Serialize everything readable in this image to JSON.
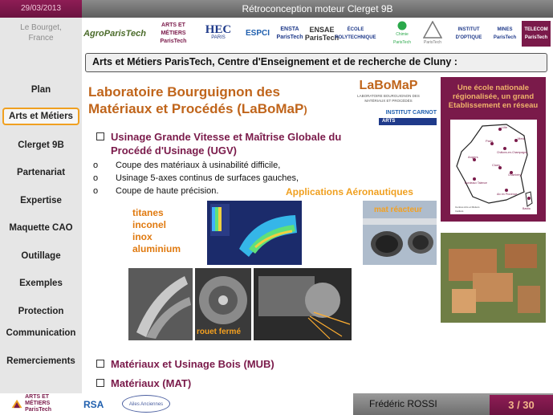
{
  "header": {
    "date": "29/03/2013",
    "title": "Rétroconception moteur Clerget 9B"
  },
  "sidebar": {
    "location_line1": "Le Bourget,",
    "location_line2": "France",
    "items": [
      {
        "label": "Plan"
      },
      {
        "label": "Arts et Métiers"
      },
      {
        "label": "Clerget 9B"
      },
      {
        "label": "Partenariat"
      },
      {
        "label": "Expertise"
      },
      {
        "label": "Maquette CAO"
      },
      {
        "label": "Outillage"
      },
      {
        "label": "Exemples"
      },
      {
        "label": "Protection"
      },
      {
        "label": "Communication"
      },
      {
        "label": "Remerciements"
      }
    ],
    "active_index": 1
  },
  "logos": {
    "agroparistech": "AgroParisTech",
    "artsetmetiers": "ARTS ET MÉTIERS ParisTech",
    "hec": "HEC",
    "hec_sub": "PARIS",
    "espci": "ESPCI",
    "ensta": "ENSTA ParisTech",
    "ensae": "ENSAE ParisTech",
    "polytechnique": "ÉCOLE POLYTECHNIQUE",
    "chimie": "Chimie ParisTech",
    "pontsparistech": "ParisTech",
    "institut_optique": "INSTITUT D'OPTIQUE",
    "mines": "MINES ParisTech",
    "telecom": "TELECOM ParisTech"
  },
  "banner": "Arts et Métiers ParisTech, Centre d'Enseignement et de recherche de Cluny :",
  "main": {
    "lab_title_line1": "Laboratoire Bourguignon des",
    "lab_title_line2": "Matériaux et Procédés (LaBoMaP",
    "lab_title_paren": ")",
    "labomap_logo": "LaBoMaP",
    "labomap_sub": "LABORATOIRE BOURGUIGNON DES MATÉRIAUX ET PROCÉDÉS",
    "carnot_logo": "INSTITUT CARNOT",
    "carnot_sub": "ARTS",
    "ugv_line1": "Usinage Grande Vitesse et Maîtrise Globale du",
    "ugv_line2": "Procédé d'Usinage (UGV)",
    "bullets": [
      "Coupe des matériaux à usinabilité difficile,",
      "Usinage 5-axes continus de surfaces gauches,",
      "Coupe de haute précision."
    ],
    "bullet_marker": "o",
    "applications": "Applications Aéronautiques",
    "materials": [
      "titanes",
      "inconel",
      "inox",
      "aluminium"
    ],
    "mat_reacteur": "mat réacteur",
    "rouet_ferme": "rouet fermé",
    "mub": "Matériaux et Usinage Bois  (MUB)",
    "mat": "Matériaux (MAT)"
  },
  "right_panel": {
    "text": "Une école nationale régionalisée, un grand Etablissement en réseau",
    "cities": [
      "Lille",
      "Metz",
      "Paris",
      "Châlons-en-Champagne",
      "Angers",
      "Cluny",
      "Bordeaux Talence",
      "Aix en Provence",
      "Chambéry",
      "Bastia"
    ],
    "legend_1": "Centres Arts et Métiers",
    "legend_2": "Instituts"
  },
  "footer": {
    "rsa": "RSA",
    "ailes": "Ailes Anciennes",
    "author": "Frédéric ROSSI",
    "page": "3 / 30"
  }
}
